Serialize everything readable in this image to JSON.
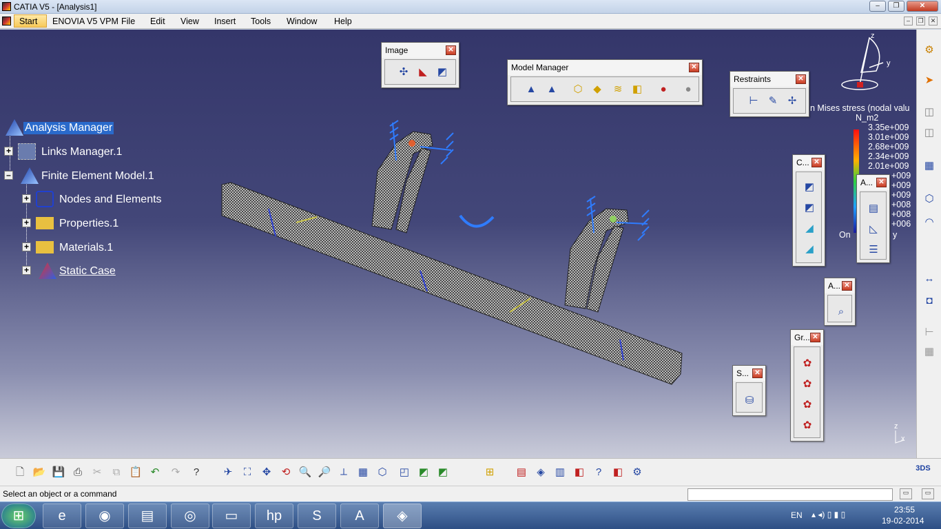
{
  "window": {
    "title": "CATIA V5 - [Analysis1]"
  },
  "menu": {
    "items": [
      "Start",
      "ENOVIA V5 VPM",
      "File",
      "Edit",
      "View",
      "Insert",
      "Tools",
      "Window",
      "Help"
    ]
  },
  "tree": {
    "root": "Analysis Manager",
    "links": "Links Manager.1",
    "fem": "Finite Element Model.1",
    "nodes": "Nodes and Elements",
    "properties": "Properties.1",
    "materials": "Materials.1",
    "static": "Static Case"
  },
  "toolbars": {
    "image": "Image",
    "model_manager": "Model Manager",
    "restraints": "Restraints",
    "c": "C...",
    "a1": "A...",
    "a2": "A...",
    "gr": "Gr...",
    "s": "S..."
  },
  "legend": {
    "title": "n Mises stress (nodal valu",
    "unit": "N_m2",
    "values": [
      "3.35e+009",
      "3.01e+009",
      "2.68e+009",
      "2.34e+009",
      "2.01e+009",
      "+009",
      "+009",
      "+009",
      "+008",
      "+008",
      "+006"
    ],
    "footer_left": "On",
    "footer_right": "y"
  },
  "compass": {
    "z": "z",
    "y": "y",
    "corner_z": "z",
    "corner_x": "x"
  },
  "status": {
    "prompt": "Select an object or a command"
  },
  "taskbar": {
    "lang": "EN",
    "time": "23:55",
    "date": "19-02-2014"
  },
  "colors": {
    "viewport_top": "#34366a",
    "selection": "#2a6acb",
    "mesh": "#2c2c2c"
  }
}
